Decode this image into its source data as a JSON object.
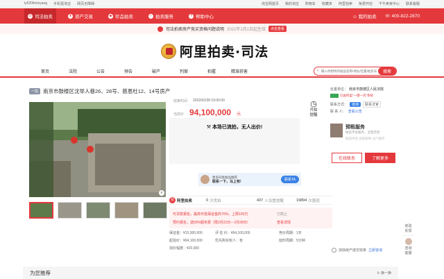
{
  "topbar": {
    "user": "ly520liminyang",
    "left_links": [
      "手机逛淘宝",
      "网页无障碍"
    ],
    "right_links": [
      "淘宝网首页",
      "我的淘宝",
      "购物车",
      "收藏夹",
      "阿里拍卖",
      "免费开店",
      "千牛卖家中心",
      "联系客服"
    ]
  },
  "redbar": {
    "tabs": [
      {
        "label": "司法拍卖",
        "active": true
      },
      {
        "label": "资产交易",
        "active": false
      },
      {
        "label": "珍品拍卖",
        "active": false
      },
      {
        "label": "拍卖服务",
        "active": false
      },
      {
        "label": "帮助中心",
        "active": false
      }
    ],
    "my_auction": "我的拍卖",
    "phone": "400-822-2870"
  },
  "notice": {
    "text": "司法拍卖房产竞买资格问题说明",
    "date": "2022年1月1日起生效",
    "tag": "点击查看"
  },
  "logo": {
    "text": "阿里拍卖·司法"
  },
  "nav": {
    "items": [
      "首页",
      "法院",
      "公告",
      "预告",
      "破产",
      "判案",
      "拍握",
      "精准获客"
    ],
    "search_placeholder": "输入你想找的拍品名称/地址/位置/拍卖号",
    "search_button": "搜索"
  },
  "listing": {
    "badge": "一拍",
    "title": "南京市鼓楼区沈举人巷26、28号、慈恩杜12、14号房产",
    "end_label": "结束时间",
    "end_value": "2022/02/28 10:00:00",
    "current_label": "当前价",
    "current_price": "94,100,000",
    "unit": "元",
    "remind_label": "开拍提醒",
    "result_msg": "本场已流拍，无人出价!",
    "bid_records": "0",
    "bid_records_label": "次竞拍",
    "reminders": "437",
    "reminders_label": "人设置提醒",
    "views": "19894",
    "views_label": "次围观"
  },
  "ad": {
    "line1": "更多同类拍品推荐",
    "line2": "联系一下，马上有!",
    "cta": "联系TA"
  },
  "notices_box": {
    "row1": "可贷款报名，最高可抵保证金的70%，上限100万",
    "row1_right": "已截止",
    "row2": "预约报名，送50%服务费（限2月22日－2月28日）",
    "row2_right": "查看详情"
  },
  "details": {
    "row1": [
      "保证金：¥15,000,000",
      "评 估 价：¥94,100,000",
      "竞价周期：1天"
    ],
    "row2": [
      "起拍价：¥94,100,000",
      "优先购买权人：有",
      "延时周期：5分钟"
    ],
    "row3": [
      "加价幅度：¥20,000",
      "",
      ""
    ]
  },
  "right": {
    "disposal_label": "处置单位：",
    "disposal_value": "南京市鼓楼区人民法院",
    "disposal_sub": "已由阿里“一键一司”系统",
    "contact_label": "联系方式：",
    "contact_value": "咨询",
    "contact_sub": "联系法官",
    "contact_person": "联 系 人：",
    "contact_link": "查看公告",
    "agent_title": "预租服务",
    "agent_sub": "拍卖平台服务，全程无忧",
    "agent_sub2": "拍前评估  竞拍担保  过户服务",
    "btn_online": "在线联系",
    "btn_more": "了解更多",
    "bottom_text": "加快房产成交效率",
    "bottom_link": "立即咨询"
  },
  "sidebar": {
    "items": [
      "体验",
      "反馈"
    ],
    "bottom": [
      "咨询",
      "客服"
    ]
  },
  "recommend": {
    "title": "为您推荐",
    "switch": "换一换"
  },
  "colors": {
    "accent": "#e4393c",
    "blue": "#3a82e6"
  }
}
